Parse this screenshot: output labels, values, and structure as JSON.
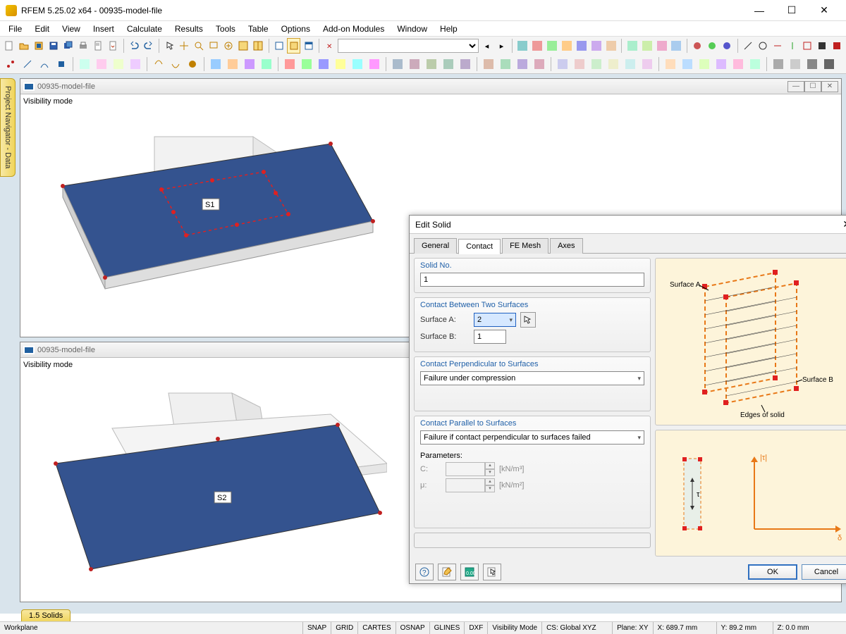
{
  "titlebar": {
    "text": "RFEM 5.25.02 x64 - 00935-model-file"
  },
  "menus": [
    "File",
    "Edit",
    "View",
    "Insert",
    "Calculate",
    "Results",
    "Tools",
    "Table",
    "Options",
    "Add-on Modules",
    "Window",
    "Help"
  ],
  "sidebar": {
    "label": "Project Navigator - Data"
  },
  "views": [
    {
      "title": "00935-model-file",
      "mode": "Visibility mode",
      "surface_label": "S1"
    },
    {
      "title": "00935-model-file",
      "mode": "Visibility mode",
      "surface_label": "S2"
    }
  ],
  "dialog": {
    "title": "Edit Solid",
    "tabs": [
      "General",
      "Contact",
      "FE Mesh",
      "Axes"
    ],
    "active_tab": 1,
    "solid_no": {
      "legend": "Solid No.",
      "value": "1"
    },
    "contact_between": {
      "legend": "Contact Between Two Surfaces",
      "surface_a_label": "Surface A:",
      "surface_a_value": "2",
      "surface_b_label": "Surface B:",
      "surface_b_value": "1"
    },
    "perpendicular": {
      "legend": "Contact Perpendicular to Surfaces",
      "value": "Failure under compression"
    },
    "parallel": {
      "legend": "Contact Parallel to Surfaces",
      "value": "Failure if contact perpendicular to surfaces failed",
      "params_label": "Parameters:",
      "c_label": "C:",
      "c_unit": "[kN/m³]",
      "mu_label": "μ:",
      "mu_unit": "[kN/m²]"
    },
    "diagram_labels": {
      "a": "Surface A",
      "b": "Surface B",
      "edges": "Edges of solid"
    },
    "graph_labels": {
      "tau_abs": "|τ|",
      "delta": "δ",
      "tau": "τ"
    },
    "buttons": {
      "ok": "OK",
      "cancel": "Cancel"
    }
  },
  "bottom_tab": "1.5 Solids",
  "status": {
    "workplane": "Workplane",
    "snap": "SNAP",
    "grid": "GRID",
    "cartes": "CARTES",
    "osnap": "OSNAP",
    "glines": "GLINES",
    "dxf": "DXF",
    "vis": "Visibility Mode",
    "cs": "CS: Global XYZ",
    "plane": "Plane: XY",
    "x": "X:  689.7 mm",
    "y": "Y:  89.2 mm",
    "z": "Z:  0.0 mm"
  }
}
